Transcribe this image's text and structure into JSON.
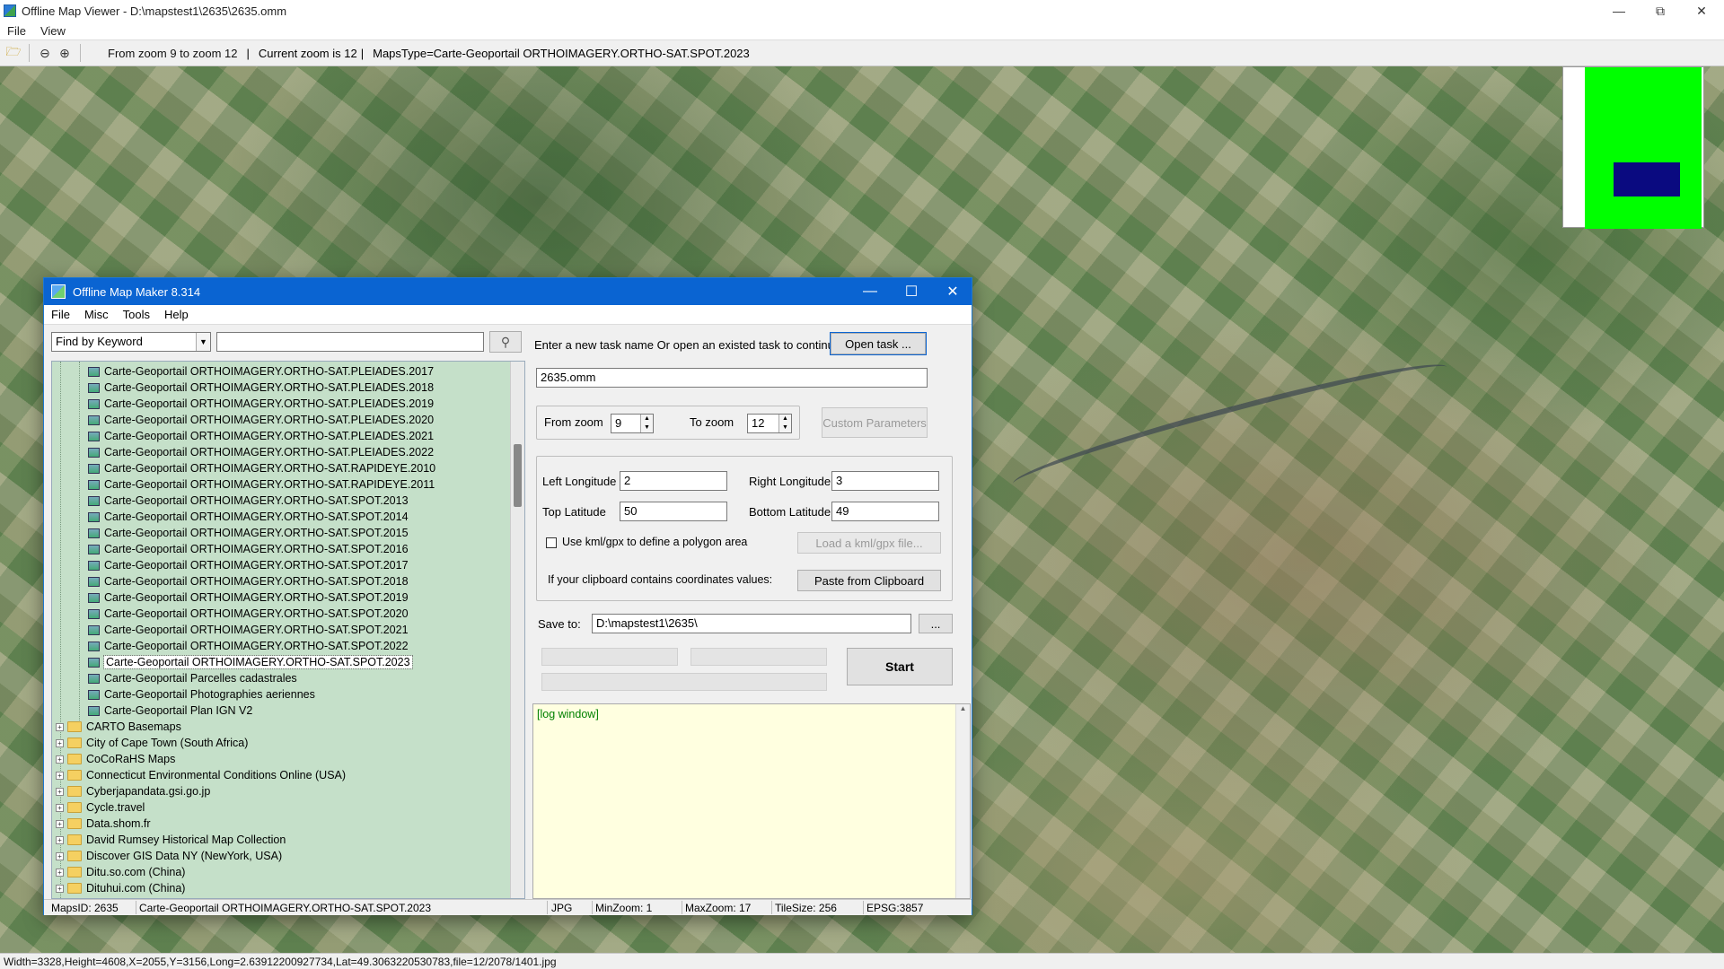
{
  "viewer": {
    "title": "Offline Map Viewer - D:\\mapstest1\\2635\\2635.omm",
    "menu": [
      "File",
      "View"
    ],
    "toolbar": {
      "zoom_range": "From zoom 9 to zoom 12",
      "current_zoom": "Current zoom is 12",
      "maps_type": "MapsType=Carte-Geoportail ORTHOIMAGERY.ORTHO-SAT.SPOT.2023"
    },
    "status": "Width=3328,Height=4608,X=2055,Y=3156,Long=2.63912200927734,Lat=49.3063220530783,file=12/2078/1401.jpg"
  },
  "maker": {
    "title": "Offline Map Maker 8.314",
    "menu": [
      "File",
      "Misc",
      "Tools",
      "Help"
    ],
    "search": {
      "mode": "Find by Keyword",
      "query": ""
    },
    "tree": {
      "leaves": [
        "Carte-Geoportail ORTHOIMAGERY.ORTHO-SAT.PLEIADES.2017",
        "Carte-Geoportail ORTHOIMAGERY.ORTHO-SAT.PLEIADES.2018",
        "Carte-Geoportail ORTHOIMAGERY.ORTHO-SAT.PLEIADES.2019",
        "Carte-Geoportail ORTHOIMAGERY.ORTHO-SAT.PLEIADES.2020",
        "Carte-Geoportail ORTHOIMAGERY.ORTHO-SAT.PLEIADES.2021",
        "Carte-Geoportail ORTHOIMAGERY.ORTHO-SAT.PLEIADES.2022",
        "Carte-Geoportail ORTHOIMAGERY.ORTHO-SAT.RAPIDEYE.2010",
        "Carte-Geoportail ORTHOIMAGERY.ORTHO-SAT.RAPIDEYE.2011",
        "Carte-Geoportail ORTHOIMAGERY.ORTHO-SAT.SPOT.2013",
        "Carte-Geoportail ORTHOIMAGERY.ORTHO-SAT.SPOT.2014",
        "Carte-Geoportail ORTHOIMAGERY.ORTHO-SAT.SPOT.2015",
        "Carte-Geoportail ORTHOIMAGERY.ORTHO-SAT.SPOT.2016",
        "Carte-Geoportail ORTHOIMAGERY.ORTHO-SAT.SPOT.2017",
        "Carte-Geoportail ORTHOIMAGERY.ORTHO-SAT.SPOT.2018",
        "Carte-Geoportail ORTHOIMAGERY.ORTHO-SAT.SPOT.2019",
        "Carte-Geoportail ORTHOIMAGERY.ORTHO-SAT.SPOT.2020",
        "Carte-Geoportail ORTHOIMAGERY.ORTHO-SAT.SPOT.2021",
        "Carte-Geoportail ORTHOIMAGERY.ORTHO-SAT.SPOT.2022",
        "Carte-Geoportail ORTHOIMAGERY.ORTHO-SAT.SPOT.2023",
        "Carte-Geoportail Parcelles cadastrales",
        "Carte-Geoportail Photographies aeriennes",
        "Carte-Geoportail Plan IGN V2"
      ],
      "selected_leaf": "Carte-Geoportail ORTHOIMAGERY.ORTHO-SAT.SPOT.2023",
      "folders": [
        "CARTO Basemaps",
        "City of Cape Town (South Africa)",
        "CoCoRaHS Maps",
        "Connecticut Environmental Conditions Online (USA)",
        "Cyberjapandata.gsi.go.jp",
        "Cycle.travel",
        "Data.shom.fr",
        "David Rumsey Historical Map Collection",
        "Discover GIS Data NY (NewYork, USA)",
        "Ditu.so.com (China)",
        "Dituhui.com (China)"
      ]
    },
    "form": {
      "task_prompt": "Enter a new task name Or open an existed task to continue:",
      "open_task": "Open task ...",
      "task_name": "2635.omm",
      "from_zoom_label": "From zoom",
      "from_zoom": "9",
      "to_zoom_label": "To zoom",
      "to_zoom": "12",
      "custom_params": "Custom Parameters",
      "left_lon_label": "Left Longitude",
      "left_lon": "2",
      "right_lon_label": "Right Longitude",
      "right_lon": "3",
      "top_lat_label": "Top Latitude",
      "top_lat": "50",
      "bottom_lat_label": "Bottom Latitude",
      "bottom_lat": "49",
      "kml_check": "Use kml/gpx to define a polygon area",
      "load_kml": "Load a kml/gpx file...",
      "clipboard_prompt": "If your clipboard contains coordinates values:",
      "paste_clipboard": "Paste from Clipboard",
      "save_label": "Save to:",
      "save_path": "D:\\mapstest1\\2635\\",
      "browse": "...",
      "start": "Start",
      "log": "[log window]"
    },
    "status": {
      "maps_id": "MapsID: 2635",
      "maps_name": "Carte-Geoportail ORTHOIMAGERY.ORTHO-SAT.SPOT.2023",
      "format": "JPG",
      "min_zoom": "MinZoom: 1",
      "max_zoom": "MaxZoom: 17",
      "tile_size": "TileSize: 256",
      "epsg": "EPSG:3857"
    }
  }
}
